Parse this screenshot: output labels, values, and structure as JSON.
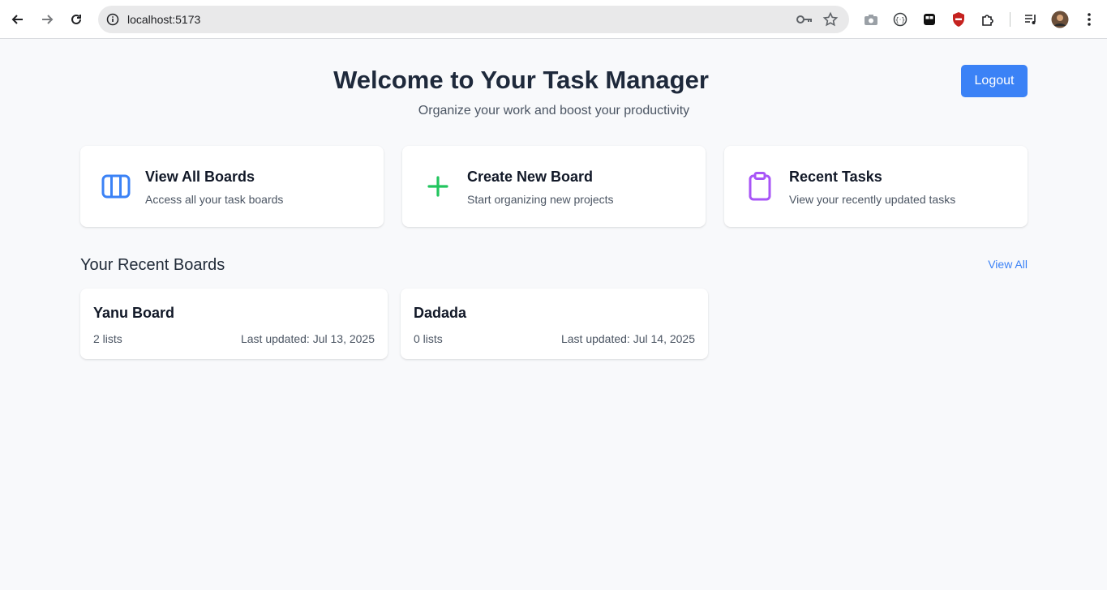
{
  "browser": {
    "url": "localhost:5173",
    "icons": [
      "back-icon",
      "forward-icon",
      "reload-icon",
      "site-info-icon",
      "password-key-icon",
      "bookmark-star-icon",
      "camera-icon",
      "extension-icon-1",
      "extension-icon-2",
      "extension-shield-icon",
      "extensions-puzzle-icon",
      "media-control-icon",
      "profile-avatar",
      "menu-kebab-icon"
    ]
  },
  "header": {
    "title": "Welcome to Your Task Manager",
    "subtitle": "Organize your work and boost your productivity",
    "logout_label": "Logout"
  },
  "actions": [
    {
      "title": "View All Boards",
      "description": "Access all your task boards",
      "icon": "columns-icon",
      "color": "#3b82f6"
    },
    {
      "title": "Create New Board",
      "description": "Start organizing new projects",
      "icon": "plus-icon",
      "color": "#22c55e"
    },
    {
      "title": "Recent Tasks",
      "description": "View your recently updated tasks",
      "icon": "clipboard-icon",
      "color": "#a855f7"
    }
  ],
  "recent": {
    "title": "Your Recent Boards",
    "view_all_label": "View All",
    "boards": [
      {
        "name": "Yanu Board",
        "lists": "2 lists",
        "updated": "Last updated: Jul 13, 2025"
      },
      {
        "name": "Dadada",
        "lists": "0 lists",
        "updated": "Last updated: Jul 14, 2025"
      }
    ]
  },
  "colors": {
    "accent": "#3b82f6",
    "background": "#f8f9fb",
    "heading": "#1e293b"
  }
}
